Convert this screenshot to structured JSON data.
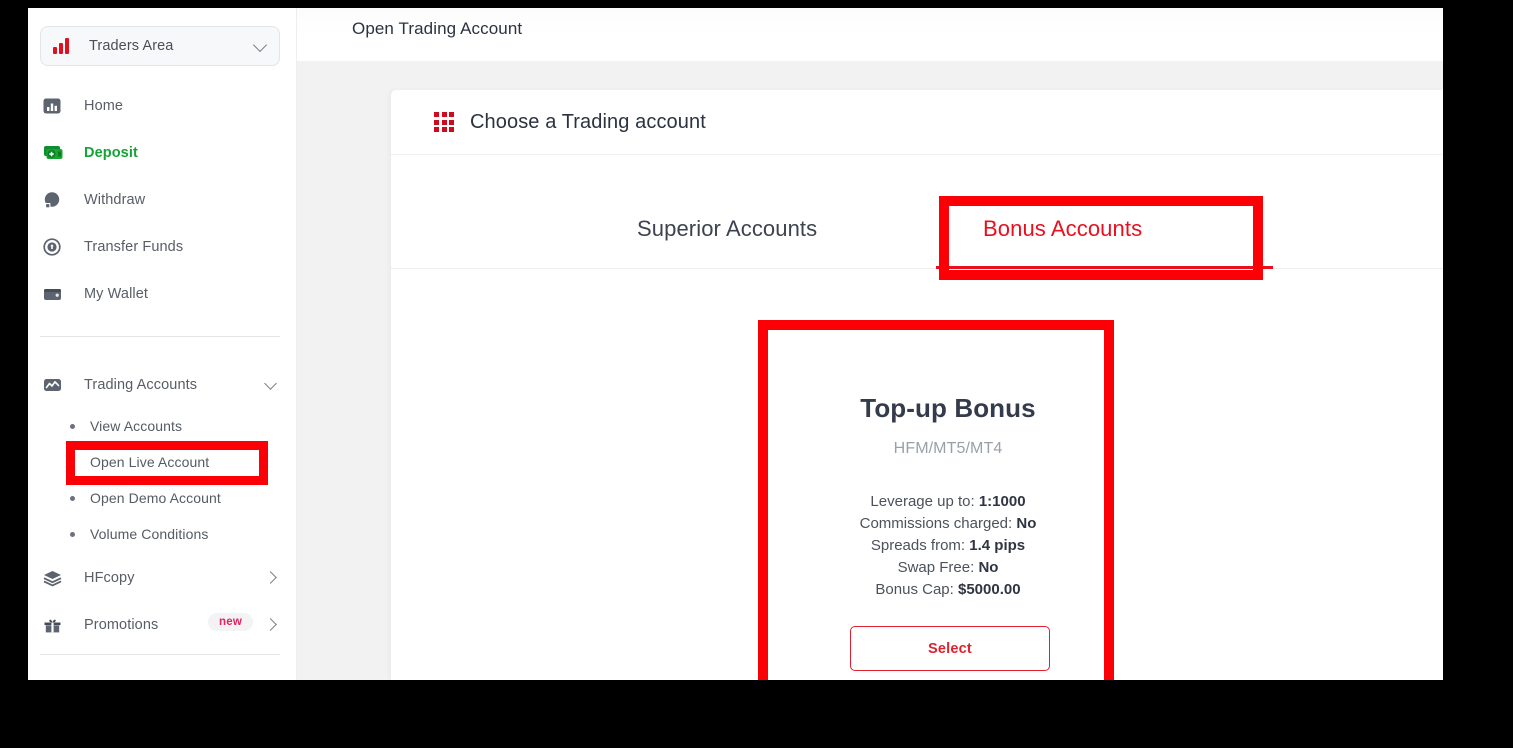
{
  "sidebar": {
    "brand": {
      "label": "Traders Area",
      "icon": "bar-chart-icon",
      "chevron": "chevron-down-icon"
    },
    "items": [
      {
        "label": "Home",
        "icon": "home-chart-icon",
        "color": "#585d66"
      },
      {
        "label": "Deposit",
        "icon": "deposit-money-icon",
        "color": "#13a435"
      },
      {
        "label": "Withdraw",
        "icon": "withdraw-pie-icon",
        "color": "#585d66"
      },
      {
        "label": "Transfer Funds",
        "icon": "transfer-funds-icon",
        "color": "#585d66"
      },
      {
        "label": "My Wallet",
        "icon": "wallet-icon",
        "color": "#585d66"
      }
    ],
    "trading_accounts": {
      "label": "Trading Accounts",
      "icon": "trading-chart-icon",
      "chevron": "chevron-down-icon"
    },
    "sub_items": [
      {
        "label": "View Accounts",
        "active": false
      },
      {
        "label": "Open Live Account",
        "active": true
      },
      {
        "label": "Open Demo Account",
        "active": false
      },
      {
        "label": "Volume Conditions",
        "active": false
      }
    ],
    "hfcopy": {
      "label": "HFcopy",
      "icon": "layers-icon",
      "chevron": "chevron-right-icon"
    },
    "promotions": {
      "label": "Promotions",
      "icon": "gift-icon",
      "chevron": "chevron-right-icon",
      "badge": "new"
    }
  },
  "topbar": {
    "title": "Open Trading Account"
  },
  "panel": {
    "title": "Choose a Trading account",
    "icon": "grid-icon",
    "tabs": [
      {
        "label": "Superior Accounts",
        "active": false
      },
      {
        "label": "Bonus Accounts",
        "active": true
      }
    ]
  },
  "card": {
    "title": "Top-up Bonus",
    "subtitle": "HFM/MT5/MT4",
    "specs": [
      {
        "label": "Leverage up to:",
        "value": "1:1000"
      },
      {
        "label": "Commissions charged:",
        "value": "No"
      },
      {
        "label": "Spreads from:",
        "value": "1.4 pips"
      },
      {
        "label": "Swap Free:",
        "value": "No"
      },
      {
        "label": "Bonus Cap:",
        "value": "$5000.00"
      }
    ],
    "select_label": "Select"
  },
  "colors": {
    "brand_red": "#e0212f",
    "annotation_red": "#fb0006",
    "deposit_green": "#13a435",
    "text_dark": "#2b3240",
    "text_muted": "#585d66"
  }
}
